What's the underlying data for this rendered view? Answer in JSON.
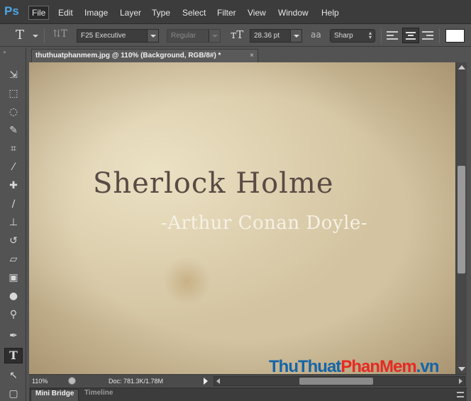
{
  "app": {
    "logo": "Ps"
  },
  "menu": {
    "items": [
      "File",
      "Edit",
      "Image",
      "Layer",
      "Type",
      "Select",
      "Filter",
      "View",
      "Window",
      "Help"
    ]
  },
  "options": {
    "font_family": "F25 Executive",
    "font_style": "Regular",
    "font_size": "28.36 pt",
    "antialias_label": "aa",
    "antialias": "Sharp",
    "text_color": "#ffffff"
  },
  "document": {
    "tab_title": "thuthuatphanmem.jpg @ 110% (Background, RGB/8#) *",
    "close_glyph": "×",
    "title_text": "Sherlock Holme",
    "subtitle_text": "-Arthur Conan Doyle-"
  },
  "status": {
    "zoom": "110%",
    "doc_size": "Doc: 781.3K/1.78M"
  },
  "watermark": {
    "part1": "ThuThuat",
    "part2": "PhanMem",
    "part3": ".vn"
  },
  "bottom_panel": {
    "tabs": [
      "Mini Bridge",
      "Timeline"
    ]
  },
  "colors": {
    "logo_blue": "#4ea6e6",
    "parchment": "#d3c3a0",
    "title_text": "#5a4a44",
    "subtitle_text": "#f6f1e4",
    "watermark_blue": "#1565a8",
    "watermark_red": "#e52a22"
  },
  "tools": [
    "move-icon",
    "marquee-icon",
    "lasso-icon",
    "quick-select-icon",
    "crop-icon",
    "eyedropper-icon",
    "healing-brush-icon",
    "brush-icon",
    "clone-stamp-icon",
    "history-brush-icon",
    "eraser-icon",
    "gradient-icon",
    "blur-icon",
    "dodge-icon",
    "pen-icon",
    "type-icon",
    "path-select-icon",
    "rectangle-icon"
  ]
}
